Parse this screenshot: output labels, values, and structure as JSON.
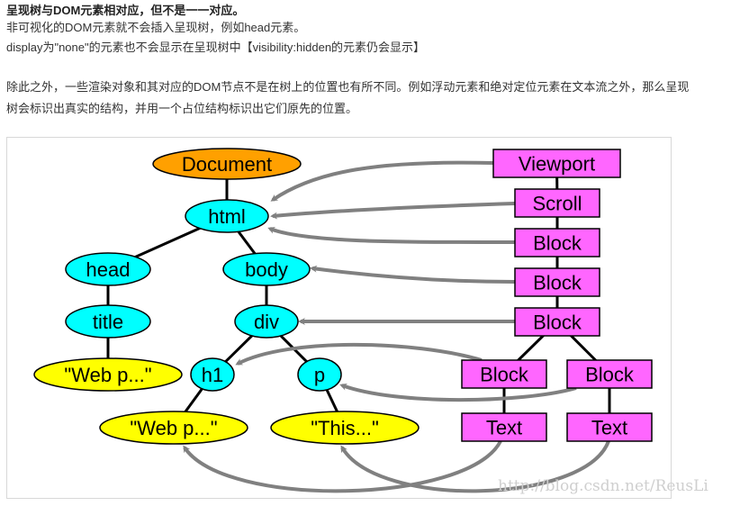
{
  "article": {
    "heading": "呈现树与DOM元素相对应，但不是一一对应。",
    "line1": "非可视化的DOM元素就不会插入呈现树，例如head元素。",
    "line2": "display为\"none\"的元素也不会显示在呈现树中【visibility:hidden的元素仍会显示】",
    "para_line1": "除此之外，一些渲染对象和其对应的DOM节点不是在树上的位置也有所不同。例如浮动元素和绝对定位元素在文本流之外，那么呈现",
    "para_line2": "树会标识出真实的结构，并用一个占位结构标识出它们原先的位置。"
  },
  "diagram": {
    "colors": {
      "document": "#ffa000",
      "element": "#00ffff",
      "text_node": "#ffff00",
      "render_box": "#ff66ff",
      "arrow": "#808080",
      "edge": "#000000"
    },
    "dom_nodes": [
      {
        "id": "document",
        "label": "Document",
        "kind": "document"
      },
      {
        "id": "html",
        "label": "html",
        "kind": "element"
      },
      {
        "id": "head",
        "label": "head",
        "kind": "element"
      },
      {
        "id": "body",
        "label": "body",
        "kind": "element"
      },
      {
        "id": "title",
        "label": "title",
        "kind": "element"
      },
      {
        "id": "div",
        "label": "div",
        "kind": "element"
      },
      {
        "id": "title_text",
        "label": "\"Web p...\"",
        "kind": "text_node"
      },
      {
        "id": "h1",
        "label": "h1",
        "kind": "element"
      },
      {
        "id": "p",
        "label": "p",
        "kind": "element"
      },
      {
        "id": "h1_text",
        "label": "\"Web p...\"",
        "kind": "text_node"
      },
      {
        "id": "p_text",
        "label": "\"This...\"",
        "kind": "text_node"
      }
    ],
    "render_nodes": [
      {
        "id": "viewport",
        "label": "Viewport"
      },
      {
        "id": "scroll",
        "label": "Scroll"
      },
      {
        "id": "block1",
        "label": "Block"
      },
      {
        "id": "block2",
        "label": "Block"
      },
      {
        "id": "block3",
        "label": "Block"
      },
      {
        "id": "block4",
        "label": "Block"
      },
      {
        "id": "block5",
        "label": "Block"
      },
      {
        "id": "text1",
        "label": "Text"
      },
      {
        "id": "text2",
        "label": "Text"
      }
    ],
    "dom_edges": [
      [
        "document",
        "html"
      ],
      [
        "html",
        "head"
      ],
      [
        "html",
        "body"
      ],
      [
        "head",
        "title"
      ],
      [
        "title",
        "title_text"
      ],
      [
        "body",
        "div"
      ],
      [
        "div",
        "h1"
      ],
      [
        "div",
        "p"
      ],
      [
        "h1",
        "h1_text"
      ],
      [
        "p",
        "p_text"
      ]
    ],
    "render_edges": [
      [
        "viewport",
        "scroll"
      ],
      [
        "scroll",
        "block1"
      ],
      [
        "block1",
        "block2"
      ],
      [
        "block2",
        "block3"
      ],
      [
        "block3",
        "block4"
      ],
      [
        "block3",
        "block5"
      ],
      [
        "block4",
        "text1"
      ],
      [
        "block5",
        "text2"
      ]
    ],
    "mappings": [
      [
        "viewport",
        "html"
      ],
      [
        "scroll",
        "html"
      ],
      [
        "block1",
        "html"
      ],
      [
        "block2",
        "body"
      ],
      [
        "block3",
        "div"
      ],
      [
        "block4",
        "h1"
      ],
      [
        "block5",
        "p"
      ],
      [
        "text1",
        "h1_text"
      ],
      [
        "text2",
        "p_text"
      ]
    ]
  },
  "watermark": "http://blog.csdn.net/ReusLi"
}
